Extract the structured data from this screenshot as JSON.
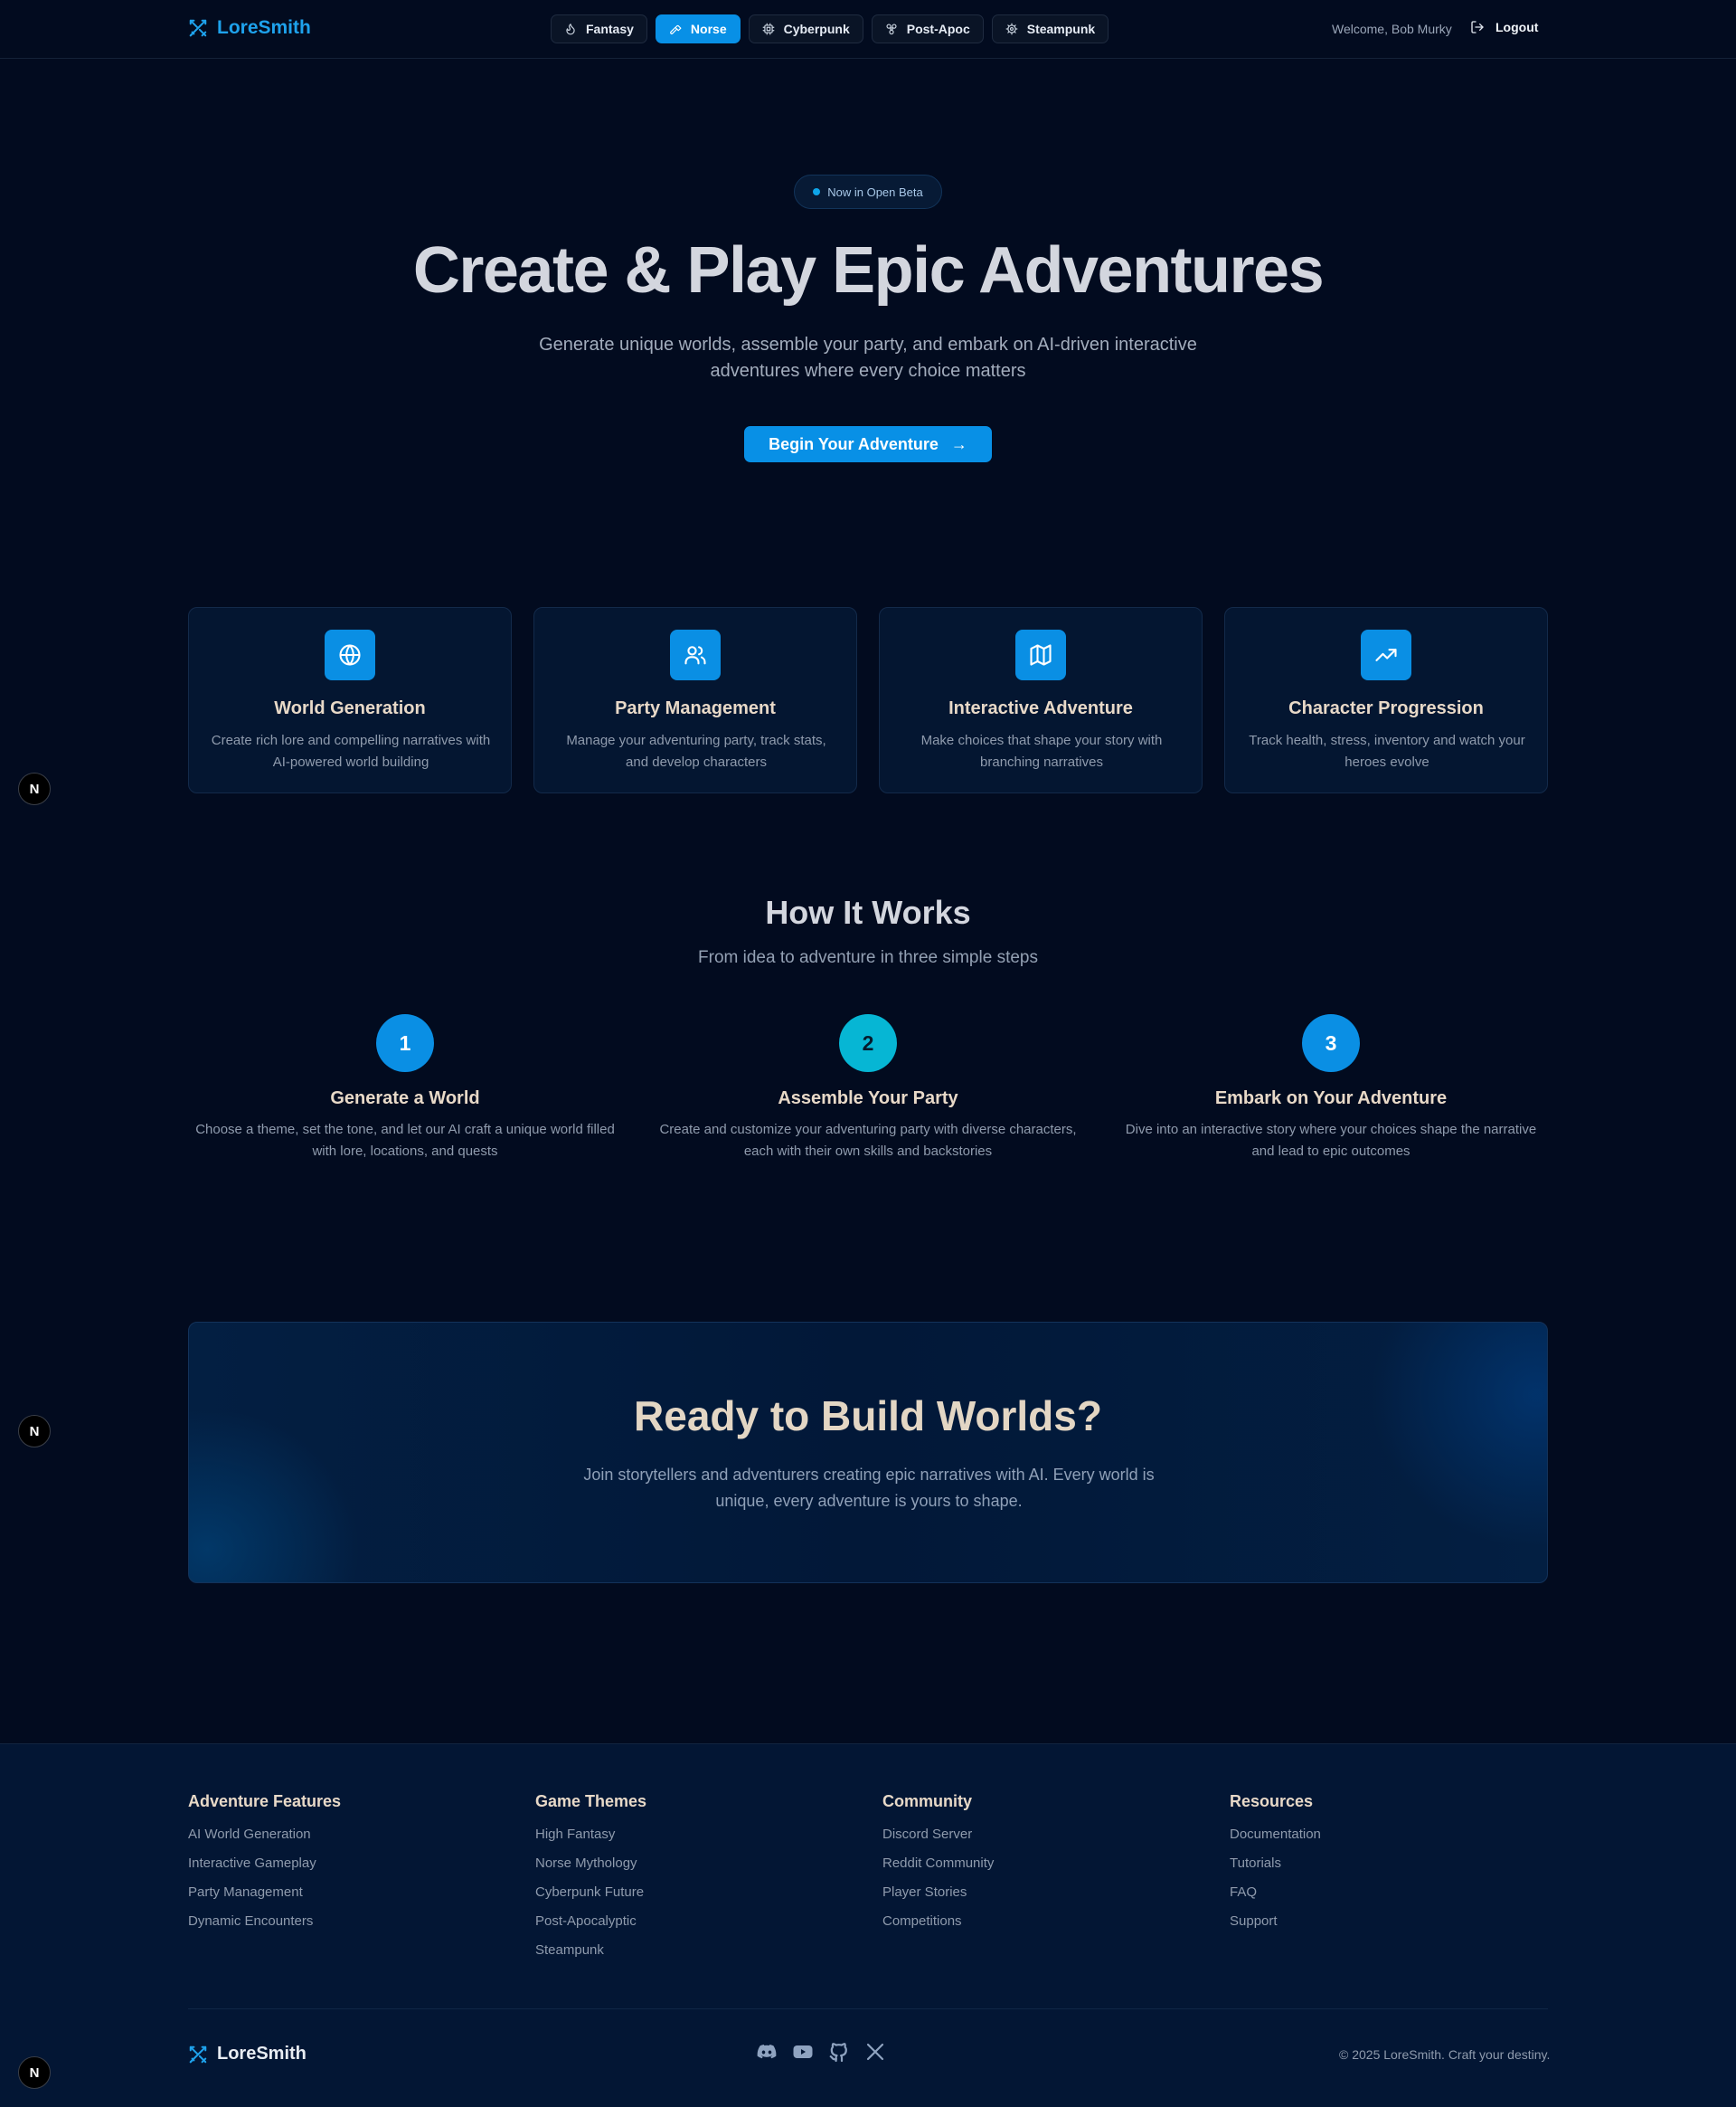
{
  "header": {
    "brand": "LoreSmith",
    "themes": [
      {
        "label": "Fantasy",
        "icon": "flame-icon"
      },
      {
        "label": "Norse",
        "icon": "hammer-icon",
        "active": true
      },
      {
        "label": "Cyberpunk",
        "icon": "cpu-icon"
      },
      {
        "label": "Post-Apoc",
        "icon": "biohazard-icon"
      },
      {
        "label": "Steampunk",
        "icon": "cog-icon"
      }
    ],
    "welcome": "Welcome, Bob Murky",
    "logout": "Logout"
  },
  "hero": {
    "badge": "Now in Open Beta",
    "title": "Create & Play Epic Adventures",
    "subtitle": "Generate unique worlds, assemble your party, and embark on AI-driven interactive adventures where every choice matters",
    "cta": "Begin Your Adventure",
    "cta_arrow": "→"
  },
  "features": [
    {
      "title": "World Generation",
      "desc": "Create rich lore and compelling narratives with AI-powered world building",
      "icon": "globe-icon"
    },
    {
      "title": "Party Management",
      "desc": "Manage your adventuring party, track stats, and develop characters",
      "icon": "users-icon"
    },
    {
      "title": "Interactive Adventure",
      "desc": "Make choices that shape your story with branching narratives",
      "icon": "map-icon"
    },
    {
      "title": "Character Progression",
      "desc": "Track health, stress, inventory and watch your heroes evolve",
      "icon": "trending-up-icon"
    }
  ],
  "how_it_works": {
    "title": "How It Works",
    "subtitle": "From idea to adventure in three simple steps",
    "steps": [
      {
        "num": "1",
        "title": "Generate a World",
        "desc": "Choose a theme, set the tone, and let our AI craft a unique world filled with lore, locations, and quests"
      },
      {
        "num": "2",
        "title": "Assemble Your Party",
        "desc": "Create and customize your adventuring party with diverse characters, each with their own skills and backstories"
      },
      {
        "num": "3",
        "title": "Embark on Your Adventure",
        "desc": "Dive into an interactive story where your choices shape the narrative and lead to epic outcomes"
      }
    ]
  },
  "banner": {
    "title": "Ready to Build Worlds?",
    "text": "Join storytellers and adventurers creating epic narratives with AI. Every world is unique, every adventure is yours to shape."
  },
  "footer": {
    "columns": [
      {
        "title": "Adventure Features",
        "links": [
          "AI World Generation",
          "Interactive Gameplay",
          "Party Management",
          "Dynamic Encounters"
        ]
      },
      {
        "title": "Game Themes",
        "links": [
          "High Fantasy",
          "Norse Mythology",
          "Cyberpunk Future",
          "Post-Apocalyptic",
          "Steampunk"
        ]
      },
      {
        "title": "Community",
        "links": [
          "Discord Server",
          "Reddit Community",
          "Player Stories",
          "Competitions"
        ]
      },
      {
        "title": "Resources",
        "links": [
          "Documentation",
          "Tutorials",
          "FAQ",
          "Support"
        ]
      }
    ],
    "brand": "LoreSmith",
    "social": [
      "discord-icon",
      "youtube-icon",
      "github-icon",
      "x-icon"
    ],
    "copyright": "© 2025 LoreSmith. Craft your destiny."
  },
  "badges": {
    "n": "N"
  },
  "colors": {
    "accent": "#0890e6",
    "accent_cyan": "#06b6d4",
    "background": "#020b1f",
    "heading_warm": "#e8d9c8"
  }
}
